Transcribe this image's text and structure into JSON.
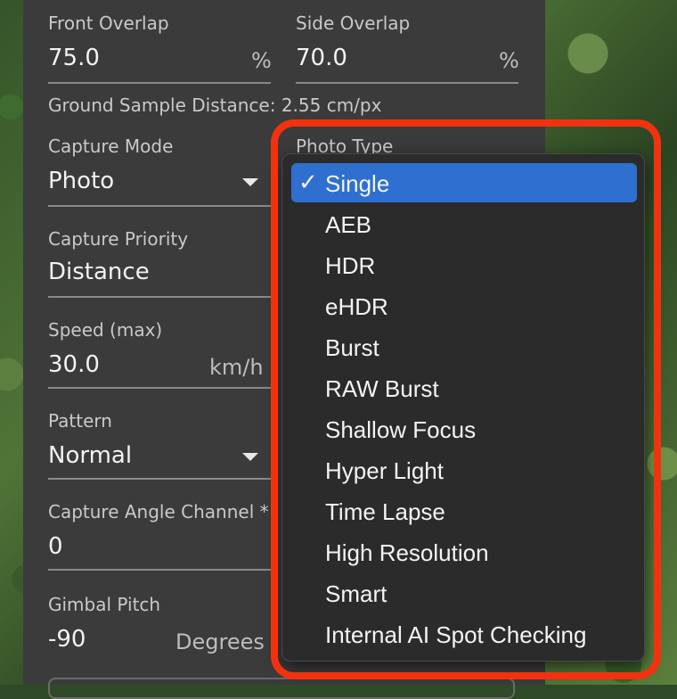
{
  "fields": {
    "front_overlap": {
      "label": "Front Overlap",
      "value": "75.0",
      "unit": "%"
    },
    "side_overlap": {
      "label": "Side Overlap",
      "value": "70.0",
      "unit": "%"
    },
    "gsd": "Ground Sample Distance: 2.55 cm/px",
    "capture_mode": {
      "label": "Capture Mode",
      "value": "Photo"
    },
    "photo_type": {
      "label": "Photo Type"
    },
    "capture_priority": {
      "label": "Capture Priority",
      "value": "Distance"
    },
    "speed": {
      "label": "Speed (max)",
      "value": "30.0",
      "unit": "km/h"
    },
    "pattern": {
      "label": "Pattern",
      "value": "Normal"
    },
    "capture_angle": {
      "label": "Capture Angle Channel *",
      "value": "0"
    },
    "gimbal_pitch": {
      "label": "Gimbal Pitch",
      "value": "-90",
      "unit": "Degrees"
    }
  },
  "dropdown": {
    "check_glyph": "✓",
    "selected_index": 0,
    "options": [
      "Single",
      "AEB",
      "HDR",
      "eHDR",
      "Burst",
      "RAW Burst",
      "Shallow Focus",
      "Hyper Light",
      "Time Lapse",
      "High Resolution",
      "Smart",
      "Internal AI Spot Checking"
    ]
  },
  "colors": {
    "panel": "#3b3b3b",
    "dropdown_bg": "#2b2b2b",
    "selected": "#2f6fd0",
    "highlight": "#f2320f"
  }
}
